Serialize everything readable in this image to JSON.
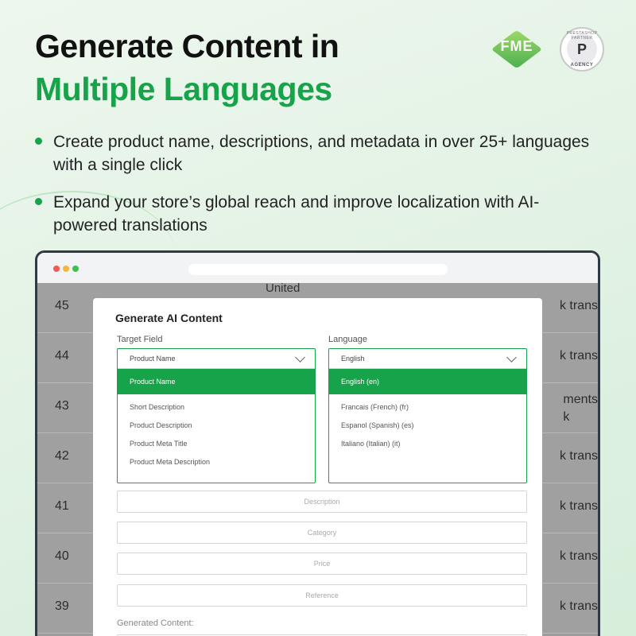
{
  "headline": {
    "line1": "Generate Content in",
    "line2": "Multiple Languages"
  },
  "logos": {
    "fme_text": "FME",
    "ps_badge_top": "PRESTASHOP PARTNER",
    "ps_badge_letter": "P",
    "ps_badge_bottom": "AGENCY"
  },
  "bullets": [
    "Create product name, descriptions, and metadata in over 25+ languages with a single click",
    "Expand your store’s global reach and improve localization with AI-powered translations"
  ],
  "colors": {
    "accent": "#16a349",
    "dark": "#111111",
    "window_frame": "#2f3a45"
  },
  "background_table": {
    "rows": [
      {
        "num": "45",
        "right": "k trans"
      },
      {
        "num": "44",
        "right": "k trans"
      },
      {
        "num": "43",
        "right": "ments\nk"
      },
      {
        "num": "42",
        "right": "k trans"
      },
      {
        "num": "41",
        "right": "k trans"
      },
      {
        "num": "40",
        "right": "k trans"
      },
      {
        "num": "39",
        "right": "k trans"
      }
    ],
    "partial_header": "United"
  },
  "modal": {
    "title": "Generate AI Content",
    "target_field": {
      "label": "Target Field",
      "value": "Product Name",
      "selected_option": "Product Name",
      "options": [
        "Short Description",
        "Product Description",
        "Product Meta Title",
        "Product Meta Description"
      ]
    },
    "language": {
      "label": "Language",
      "value": "English",
      "selected_option": "English (en)",
      "options": [
        "Francais (French) (fr)",
        "Espanol (Spanish) (es)",
        "Italiano (Italian) (it)"
      ]
    },
    "inputs": [
      {
        "placeholder": "Description"
      },
      {
        "placeholder": "Category"
      },
      {
        "placeholder": "Price"
      },
      {
        "placeholder": "Reference"
      }
    ],
    "generated_label": "Generated Content:"
  }
}
